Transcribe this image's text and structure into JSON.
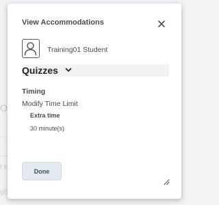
{
  "background": {
    "fragment_o": "Op",
    "fragment_n": "t N",
    "fragment_g": "g0"
  },
  "dialog": {
    "title": "View Accommodations",
    "close_icon": "close-icon",
    "user": {
      "avatar_icon": "user-avatar-icon",
      "name": "Training01 Student"
    },
    "section": {
      "label": "Quizzes",
      "toggle_icon": "chevron-down-icon"
    },
    "timing": {
      "heading": "Timing",
      "modify_label": "Modify Time Limit",
      "extra_time_label": "Extra time",
      "extra_time_value": "30 minute(s)"
    },
    "done_label": "Done",
    "resize_icon": "resize-handle-icon"
  },
  "colors": {
    "text": "#494c4e",
    "section_bar": "#f1f2f4",
    "button_bg": "#e3e9f1"
  }
}
